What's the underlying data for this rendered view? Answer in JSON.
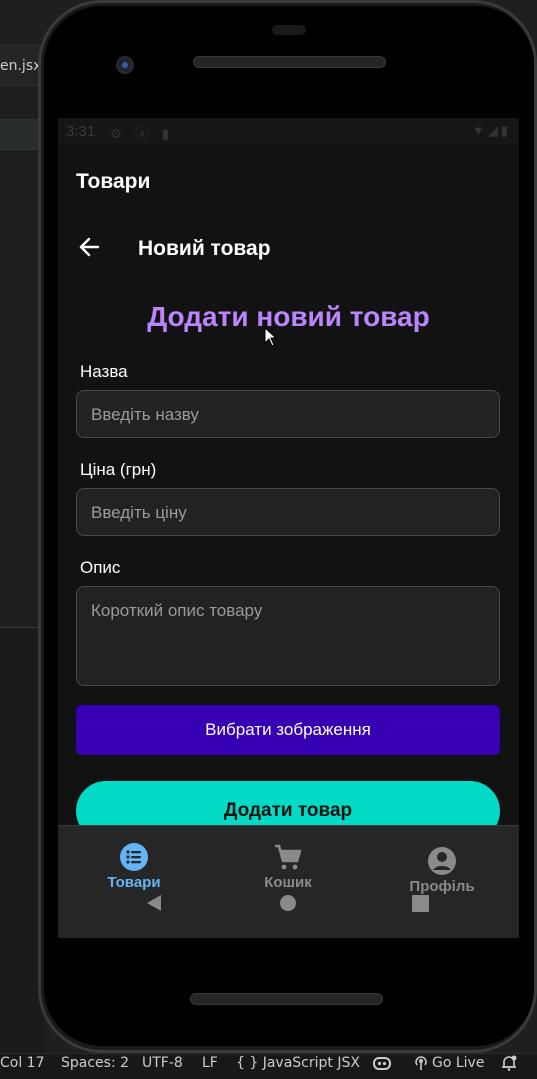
{
  "editor": {
    "tab_filename": "en.jsx",
    "status_bar": {
      "position": "Col 17",
      "spaces": "Spaces: 2",
      "encoding": "UTF-8",
      "eol": "LF",
      "language": "{ } JavaScript JSX",
      "go_live": "Go Live"
    }
  },
  "device": {
    "status_bar": {
      "time": "3:31"
    },
    "app_bar": {
      "title": "Товари"
    },
    "screen_header": {
      "title": "Новий товар",
      "back_icon": "arrow-left-icon"
    },
    "form": {
      "heading": "Додати новий товар",
      "name_label": "Назва",
      "name_placeholder": "Введіть назву",
      "price_label": "Ціна (грн)",
      "price_placeholder": "Введіть ціну",
      "description_label": "Опис",
      "description_placeholder": "Короткий опис товару",
      "pick_image_button": "Вибрати зображення",
      "submit_button": "Додати товар"
    },
    "tabs": [
      {
        "label": "Товари",
        "icon": "list-icon",
        "active": true
      },
      {
        "label": "Кошик",
        "icon": "cart-icon",
        "active": false
      },
      {
        "label": "Профіль",
        "icon": "person-icon",
        "active": false
      }
    ],
    "colors": {
      "accent_heading": "#bb86fc",
      "primary_button": "#3700b3",
      "secondary_button": "#03dac6",
      "active_tab": "#64b5f6",
      "background": "#121212"
    }
  }
}
